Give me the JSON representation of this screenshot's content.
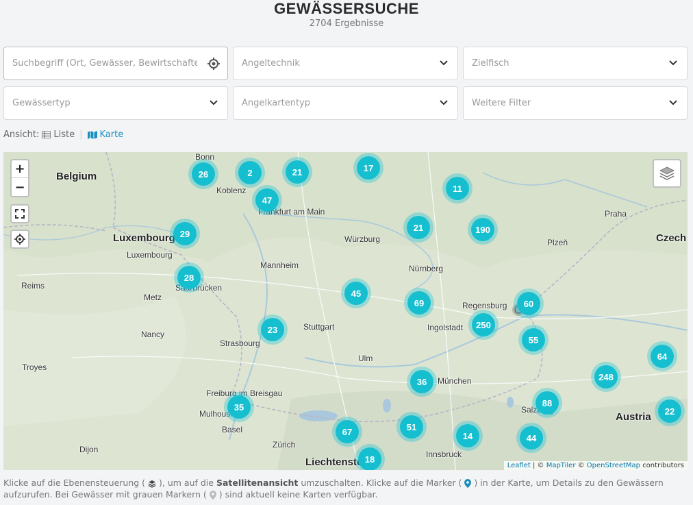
{
  "header": {
    "title": "GEWÄSSERSUCHE",
    "results": "2704 Ergebnisse"
  },
  "filters": {
    "search_placeholder": "Suchbegriff (Ort, Gewässer, Bewirtschafter",
    "angeltechnik": "Angeltechnik",
    "zielfisch": "Zielfisch",
    "gewaessertyp": "Gewässertyp",
    "angelkartentyp": "Angelkartentyp",
    "weitere": "Weitere Filter"
  },
  "view": {
    "label": "Ansicht:",
    "list": "Liste",
    "map": "Karte"
  },
  "map": {
    "zoom_in": "+",
    "zoom_out": "−",
    "attribution": {
      "leaflet": "Leaflet",
      "maptiler": "MapTiler",
      "osm": "OpenStreetMap",
      "contributors": "contributors",
      "sep1": " | © ",
      "sep2": " © "
    },
    "clusters": [
      "26",
      "2",
      "21",
      "17",
      "11",
      "47",
      "29",
      "21",
      "190",
      "28",
      "45",
      "69",
      "60",
      "250",
      "55",
      "23",
      "36",
      "64",
      "248",
      "88",
      "35",
      "51",
      "67",
      "14",
      "44",
      "22",
      "18"
    ],
    "places": [
      "Bonn",
      "Belgium",
      "Koblenz",
      "Frankfurt am Main",
      "Luxembourg",
      "Luxembourg",
      "Würzburg",
      "Praha",
      "Czech",
      "Plzeň",
      "Reims",
      "Mannheim",
      "Nürnberg",
      "Metz",
      "Saarbrücken",
      "Regensburg",
      "Ingolstadt",
      "Stuttgart",
      "Nancy",
      "Strasbourg",
      "Troyes",
      "Ulm",
      "München",
      "Freiburg im Breisgau",
      "Mulhouse",
      "Basel",
      "Salzburg",
      "Austria",
      "Dijon",
      "Zürich",
      "Innsbruck",
      "Liechtenstein"
    ]
  },
  "footer": {
    "p1": "Klicke auf die Ebenensteuerung (",
    "p2": "), um auf die ",
    "bold": "Satellitenansicht",
    "p3": " umzuschalten. Klicke auf die Marker (",
    "p4": ") in der Karte, um Details zu den Gewässern aufzurufen. Bei Gewässer mit grauen Markern (",
    "p5": ") sind aktuell keine Karten verfügbar."
  }
}
